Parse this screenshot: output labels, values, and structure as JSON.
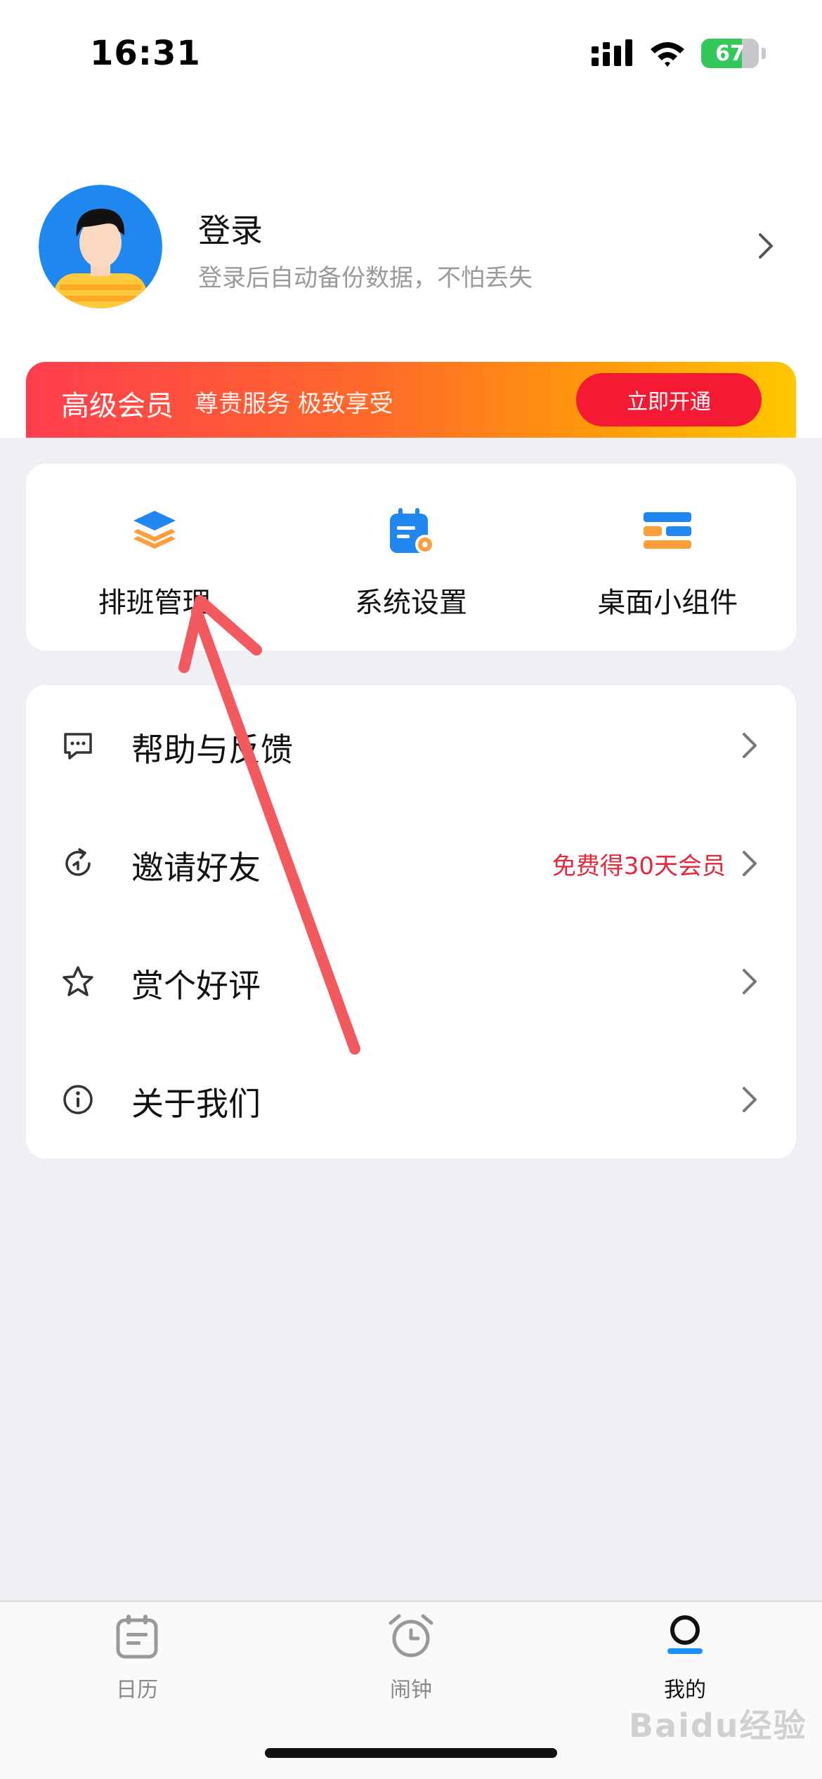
{
  "status_bar": {
    "time": "16:31",
    "battery": "67"
  },
  "profile": {
    "title": "登录",
    "subtitle": "登录后自动备份数据，不怕丢失",
    "avatar_icon": "user-avatar"
  },
  "vip": {
    "title": "高级会员",
    "subtitle": "尊贵服务 极致享受",
    "button_label": "立即开通",
    "colors": [
      "#ff3d4f",
      "#ff9a0a",
      "#ffc800"
    ]
  },
  "tools": [
    {
      "label": "排班管理",
      "icon": "layers-icon"
    },
    {
      "label": "系统设置",
      "icon": "calendar-gear-icon"
    },
    {
      "label": "桌面小组件",
      "icon": "widget-icon"
    }
  ],
  "menu": [
    {
      "label": "帮助与反馈",
      "icon": "chat-icon",
      "extra": ""
    },
    {
      "label": "邀请好友",
      "icon": "refresh-icon",
      "extra": "免费得30天会员"
    },
    {
      "label": "赏个好评",
      "icon": "star-icon",
      "extra": ""
    },
    {
      "label": "关于我们",
      "icon": "info-icon",
      "extra": ""
    }
  ],
  "tabbar": [
    {
      "label": "日历",
      "icon": "calendar-icon",
      "active": false
    },
    {
      "label": "闹钟",
      "icon": "alarm-icon",
      "active": false
    },
    {
      "label": "我的",
      "icon": "person-icon",
      "active": true
    }
  ],
  "watermark": "Baidu经验",
  "accent_color": "#1890ff",
  "annotation_color": "#f25a5f"
}
